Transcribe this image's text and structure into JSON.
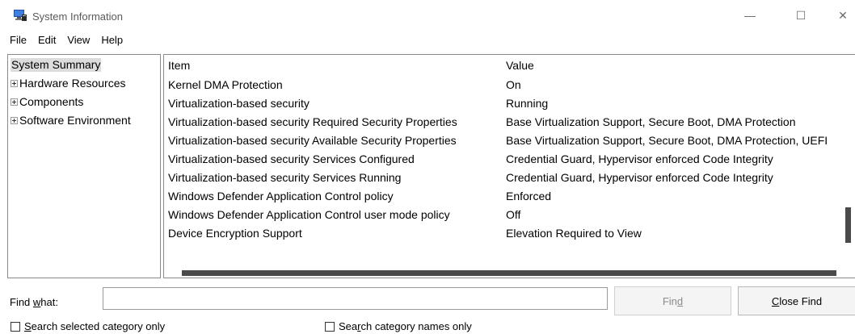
{
  "window": {
    "title": "System Information",
    "controls": {
      "minimize": "—",
      "maximize": "☐",
      "close": "✕"
    }
  },
  "menu": [
    "File",
    "Edit",
    "View",
    "Help"
  ],
  "tree": {
    "root": "System Summary",
    "nodes": [
      "Hardware Resources",
      "Components",
      "Software Environment"
    ]
  },
  "details": {
    "headers": {
      "item": "Item",
      "value": "Value"
    },
    "rows": [
      {
        "item": "Kernel DMA Protection",
        "value": "On"
      },
      {
        "item": "Virtualization-based security",
        "value": "Running"
      },
      {
        "item": "Virtualization-based security Required Security Properties",
        "value": "Base Virtualization Support, Secure Boot, DMA Protection"
      },
      {
        "item": "Virtualization-based security Available Security Properties",
        "value": "Base Virtualization Support, Secure Boot, DMA Protection, UEFI"
      },
      {
        "item": "Virtualization-based security Services Configured",
        "value": "Credential Guard, Hypervisor enforced Code Integrity"
      },
      {
        "item": "Virtualization-based security Services Running",
        "value": "Credential Guard, Hypervisor enforced Code Integrity"
      },
      {
        "item": "Windows Defender Application Control policy",
        "value": "Enforced"
      },
      {
        "item": "Windows Defender Application Control user mode policy",
        "value": "Off"
      },
      {
        "item": "Device Encryption Support",
        "value": "Elevation Required to View"
      }
    ]
  },
  "find": {
    "label_pre": "Find ",
    "label_key": "w",
    "label_post": "hat:",
    "input_value": "",
    "find_pre": "Fin",
    "find_key": "d",
    "find_post": "",
    "close_pre": "",
    "close_key": "C",
    "close_post": "lose Find"
  },
  "options": {
    "search_selected_pre": "",
    "search_selected_key": "S",
    "search_selected_post": "earch selected category only",
    "search_names_pre": "Sea",
    "search_names_key": "r",
    "search_names_post": "ch category names only"
  }
}
